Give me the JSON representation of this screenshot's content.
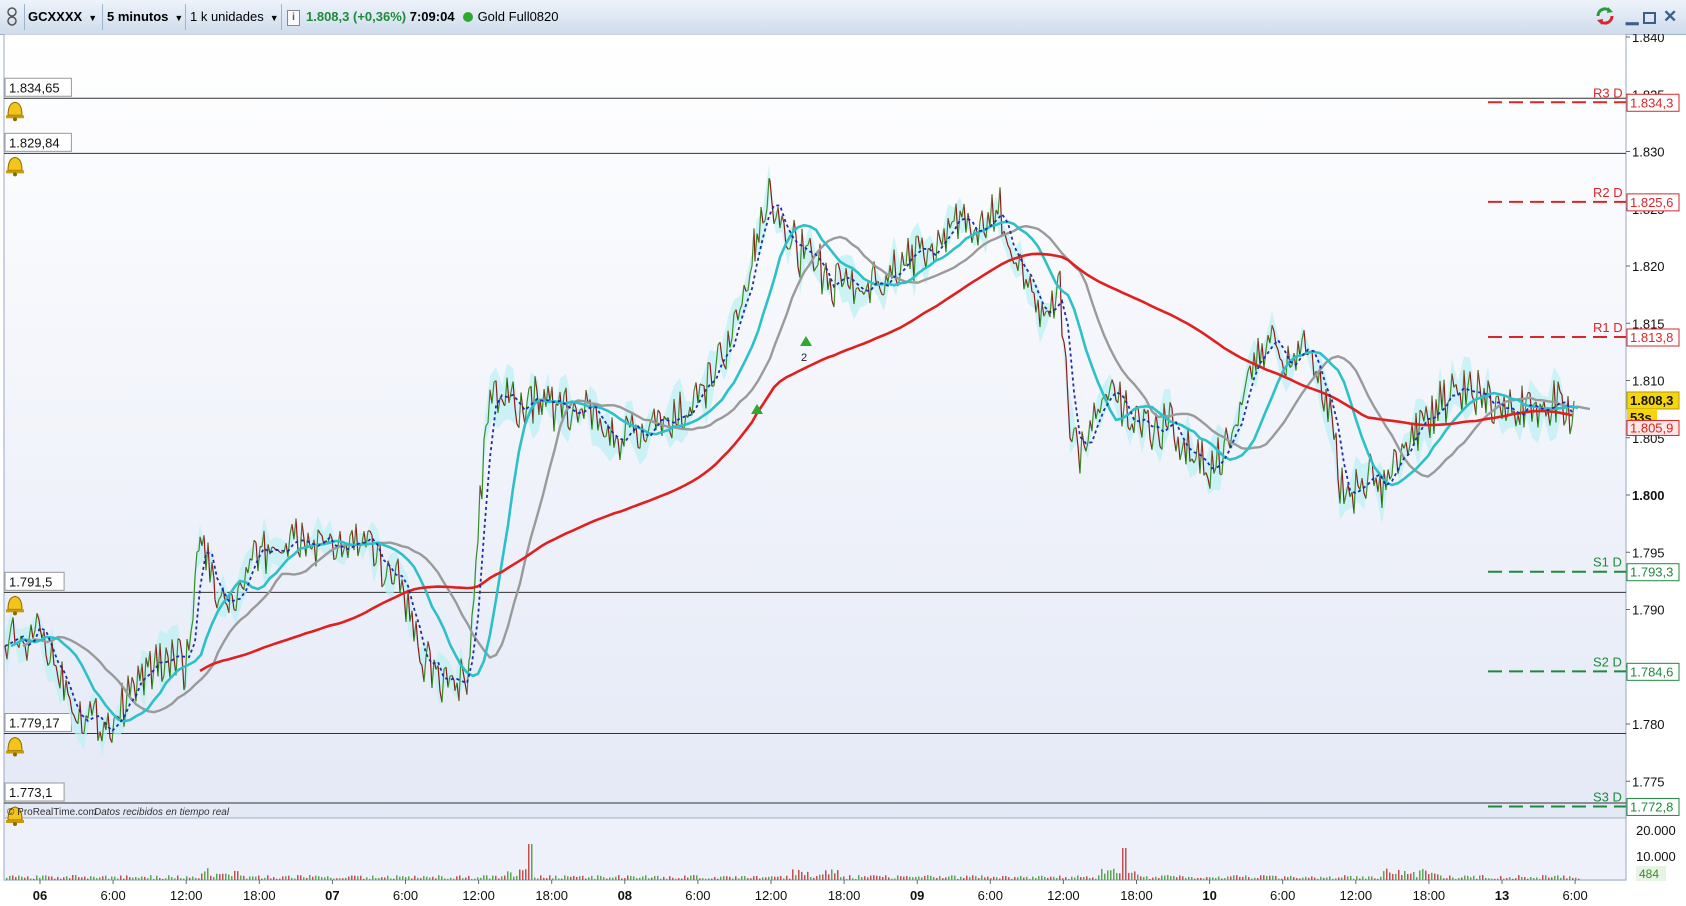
{
  "toolbar": {
    "instrument": "GCXXXX",
    "timeframe": "5 minutos",
    "units": "1 k unidades",
    "info_icon": "info-icon",
    "last_price": "1.808,3",
    "change": "(+0,36%)",
    "time": "7:09:04",
    "feed_status_color": "#2fa82f",
    "contract": "Gold Full0820",
    "sync_icon": "sync-icon",
    "window_controls": [
      "minimize-icon",
      "restore-icon",
      "close-icon"
    ]
  },
  "chart": {
    "price_axis": [
      "1.840",
      "1.835",
      "1.830",
      "1.825",
      "1.820",
      "1.815",
      "1.810",
      "1.805",
      "1.800",
      "1.795",
      "1.790",
      "1.785",
      "1.780",
      "1.775"
    ],
    "alert_lines": [
      {
        "label": "1.834,65",
        "value": 1834.65
      },
      {
        "label": "1.829,84",
        "value": 1829.84
      },
      {
        "label": "1.791,5",
        "value": 1791.5
      },
      {
        "label": "1.779,17",
        "value": 1779.17
      },
      {
        "label": "1.773,1",
        "value": 1773.1
      }
    ],
    "pivot_levels": [
      {
        "name": "R3 D",
        "label": "1.834,3",
        "value": 1834.3,
        "color": "#d9262b"
      },
      {
        "name": "R2 D",
        "label": "1.825,6",
        "value": 1825.6,
        "color": "#d9262b"
      },
      {
        "name": "R1 D",
        "label": "1.813,8",
        "value": 1813.8,
        "color": "#d9262b"
      },
      {
        "name": "S1 D",
        "label": "1.793,3",
        "value": 1793.3,
        "color": "#1f8a3c"
      },
      {
        "name": "S2 D",
        "label": "1.784,6",
        "value": 1784.6,
        "color": "#1f8a3c"
      },
      {
        "name": "S3 D",
        "label": "1.772,8",
        "value": 1772.8,
        "color": "#1f8a3c"
      }
    ],
    "last_price_badge": "1.808,3",
    "countdown": "53s",
    "ma_badge": "1.805,9",
    "marker_label": "2",
    "credit": "© ProRealTime.com",
    "credit_note": "Datos recibidos en tiempo real",
    "volume_axis": [
      "20.000",
      "10.000"
    ],
    "volume_badge": "484",
    "time_axis": [
      {
        "label": "06",
        "bold": true
      },
      {
        "label": "6:00",
        "bold": false
      },
      {
        "label": "12:00",
        "bold": false
      },
      {
        "label": "18:00",
        "bold": false
      },
      {
        "label": "07",
        "bold": true
      },
      {
        "label": "6:00",
        "bold": false
      },
      {
        "label": "12:00",
        "bold": false
      },
      {
        "label": "18:00",
        "bold": false
      },
      {
        "label": "08",
        "bold": true
      },
      {
        "label": "6:00",
        "bold": false
      },
      {
        "label": "12:00",
        "bold": false
      },
      {
        "label": "18:00",
        "bold": false
      },
      {
        "label": "09",
        "bold": true
      },
      {
        "label": "6:00",
        "bold": false
      },
      {
        "label": "12:00",
        "bold": false
      },
      {
        "label": "18:00",
        "bold": false
      },
      {
        "label": "10",
        "bold": true
      },
      {
        "label": "6:00",
        "bold": false
      },
      {
        "label": "12:00",
        "bold": false
      },
      {
        "label": "18:00",
        "bold": false
      },
      {
        "label": "13",
        "bold": true
      },
      {
        "label": "6:00",
        "bold": false
      }
    ],
    "colors": {
      "price_up": "#3c8c2a",
      "price_down": "#8b1a1a",
      "ma_long": "#e02020",
      "ma_cyan": "#2cc0c8",
      "ma_gray": "#9a9a9a",
      "ma_dotted": "#1c2fa8",
      "cloud": "#bdf0f4",
      "volume": "#5aa64a"
    }
  }
}
